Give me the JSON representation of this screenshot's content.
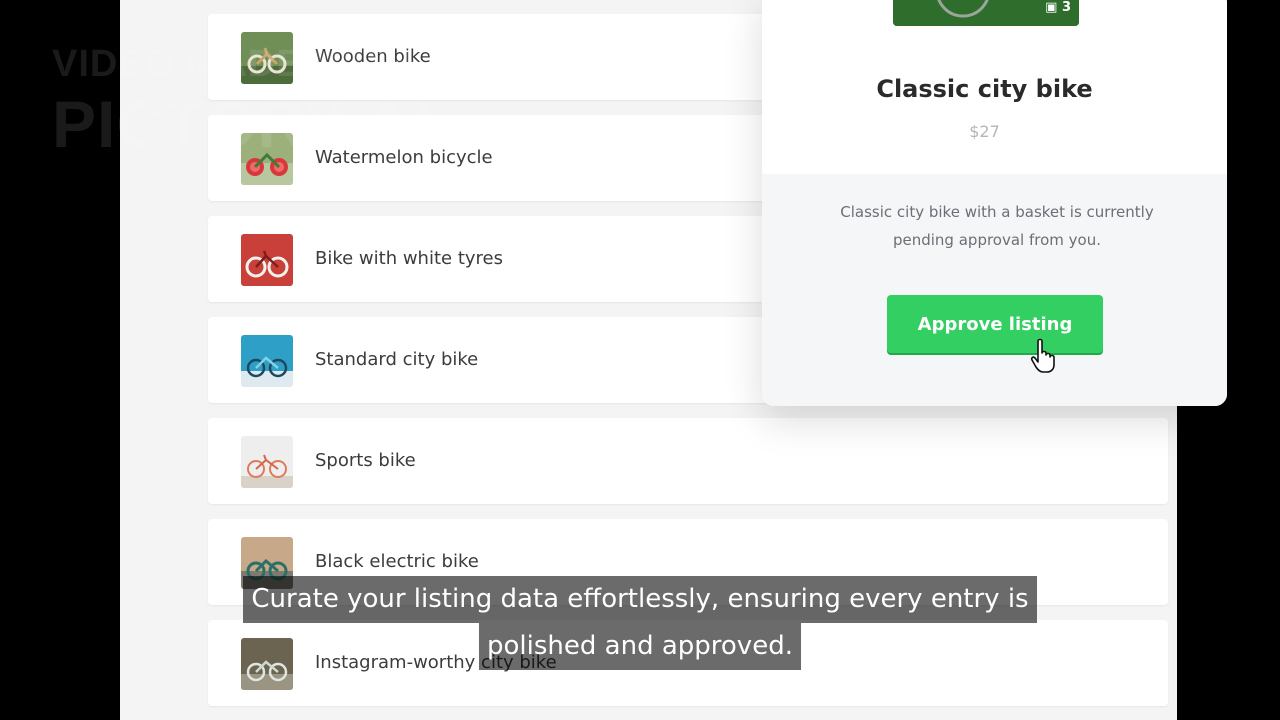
{
  "watermark": {
    "line1": "VIDEO MADE WITH",
    "line2": "PICTORY AI"
  },
  "listings": [
    {
      "title": "Wooden bike",
      "thumb": "wooden-bike"
    },
    {
      "title": "Watermelon bicycle",
      "thumb": "watermelon-bike"
    },
    {
      "title": "Bike with white tyres",
      "thumb": "red-wall-bike"
    },
    {
      "title": "Standard city bike",
      "thumb": "blue-bike"
    },
    {
      "title": "Sports bike",
      "thumb": "white-wall-bike"
    },
    {
      "title": "Black electric bike",
      "thumb": "teal-bike"
    },
    {
      "title": "Instagram-worthy city bike",
      "thumb": "street-bike"
    }
  ],
  "detail": {
    "photo_count": "3",
    "title": "Classic city bike",
    "price": "$27",
    "description": "Classic city bike with a basket is currently pending approval from you.",
    "approve_label": "Approve listing"
  },
  "caption": {
    "line1": "Curate your listing data effortlessly, ensuring every entry is",
    "line2": "polished and approved."
  },
  "colors": {
    "approve": "#34cf62",
    "background": "#f4f4f4"
  }
}
